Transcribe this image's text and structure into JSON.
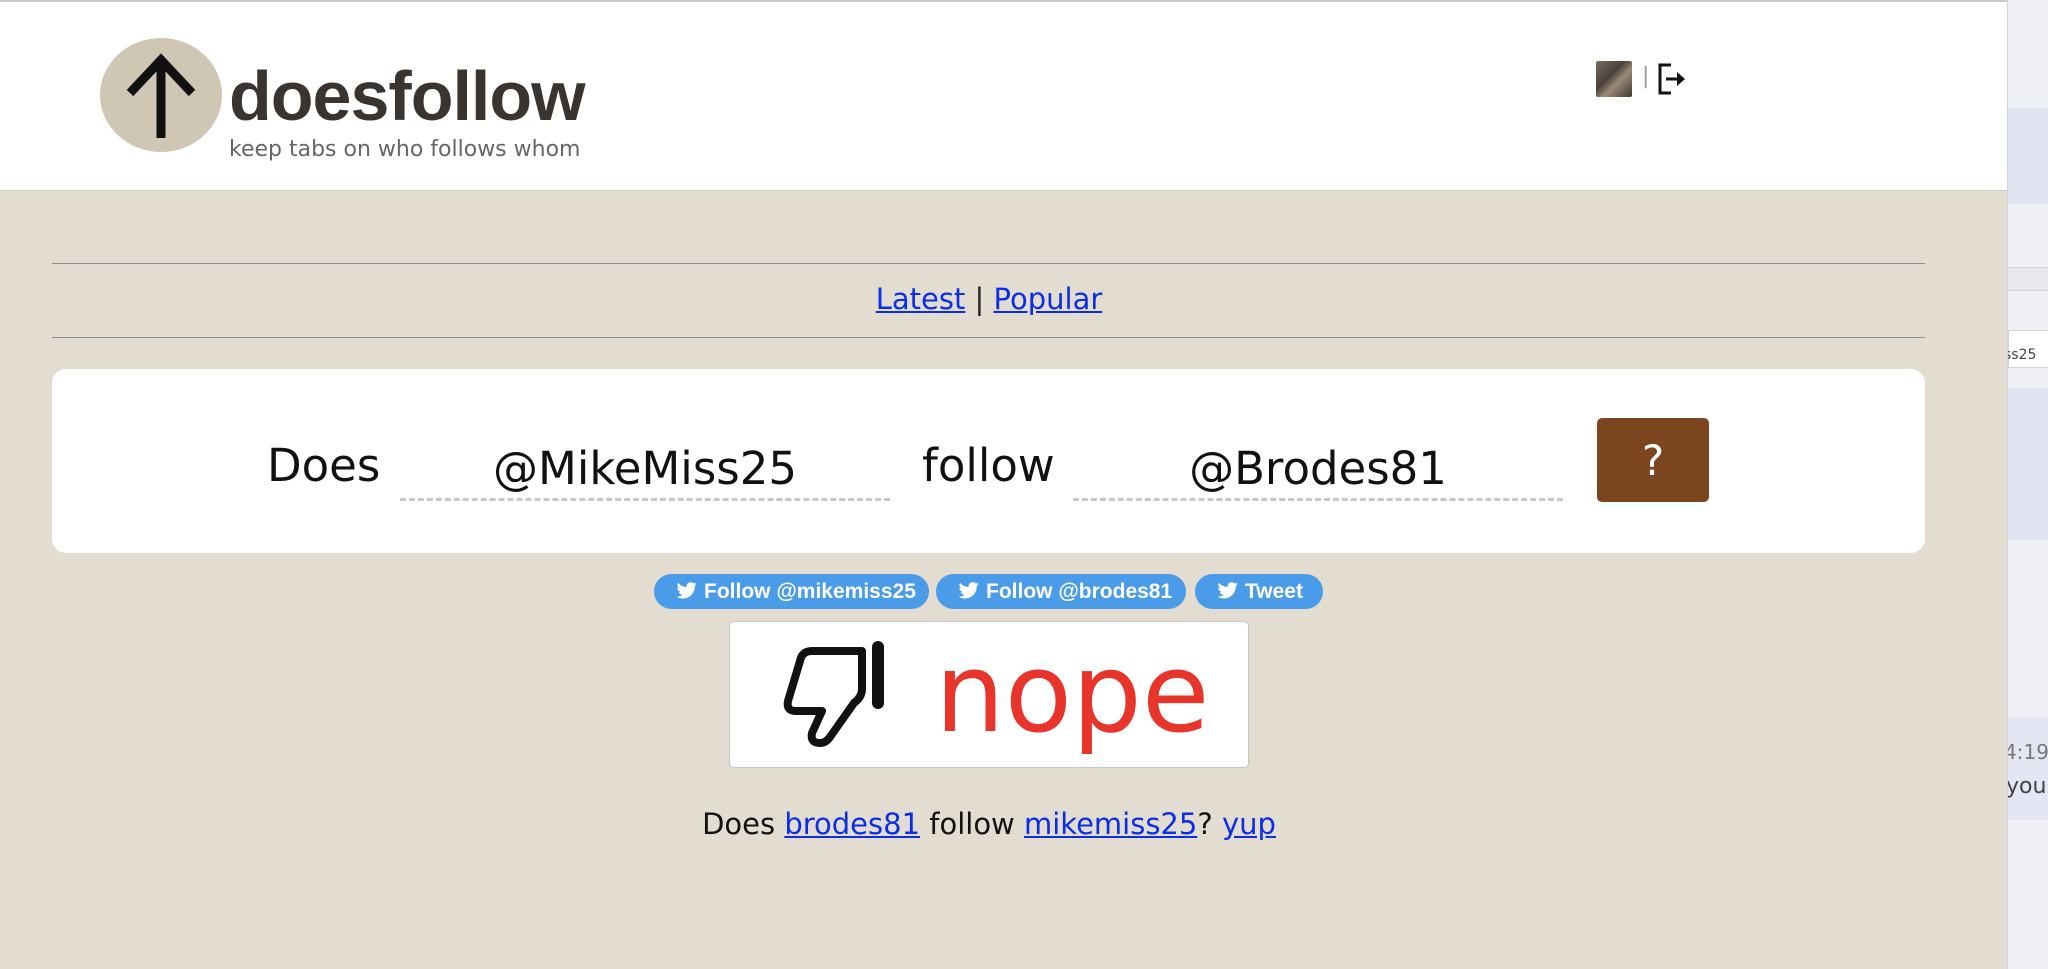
{
  "header": {
    "site_name": "doesfollow",
    "tagline": "keep tabs on who follows whom"
  },
  "nav": {
    "latest_label": "Latest",
    "separator": "|",
    "popular_label": "Popular",
    "header_separator": "|"
  },
  "question": {
    "word_does": "Does",
    "user_a": "@MikeMiss25",
    "word_follow": "follow",
    "user_b": "@Brodes81",
    "submit_label": "?"
  },
  "twitter_buttons": [
    {
      "label": "Follow @mikemiss25"
    },
    {
      "label": "Follow @brodes81"
    },
    {
      "label": "Tweet"
    }
  ],
  "result": {
    "word": "nope",
    "color": "#e8352b",
    "icon": "thumbs-down-icon"
  },
  "reverse": {
    "prefix": "Does",
    "user_b_link": "brodes81",
    "middle": "follow",
    "user_a_link": "mikemiss25",
    "qmark": "?",
    "answer_link": "yup"
  },
  "side_strip": {
    "snippet_a": "ss25",
    "snippet_b": "4:19",
    "snippet_c": "you"
  },
  "colors": {
    "page_bg": "#e2ddd0",
    "submit_bg": "#7b4520",
    "twitter_blue": "#4a9be8",
    "link": "#0a2ee8"
  }
}
